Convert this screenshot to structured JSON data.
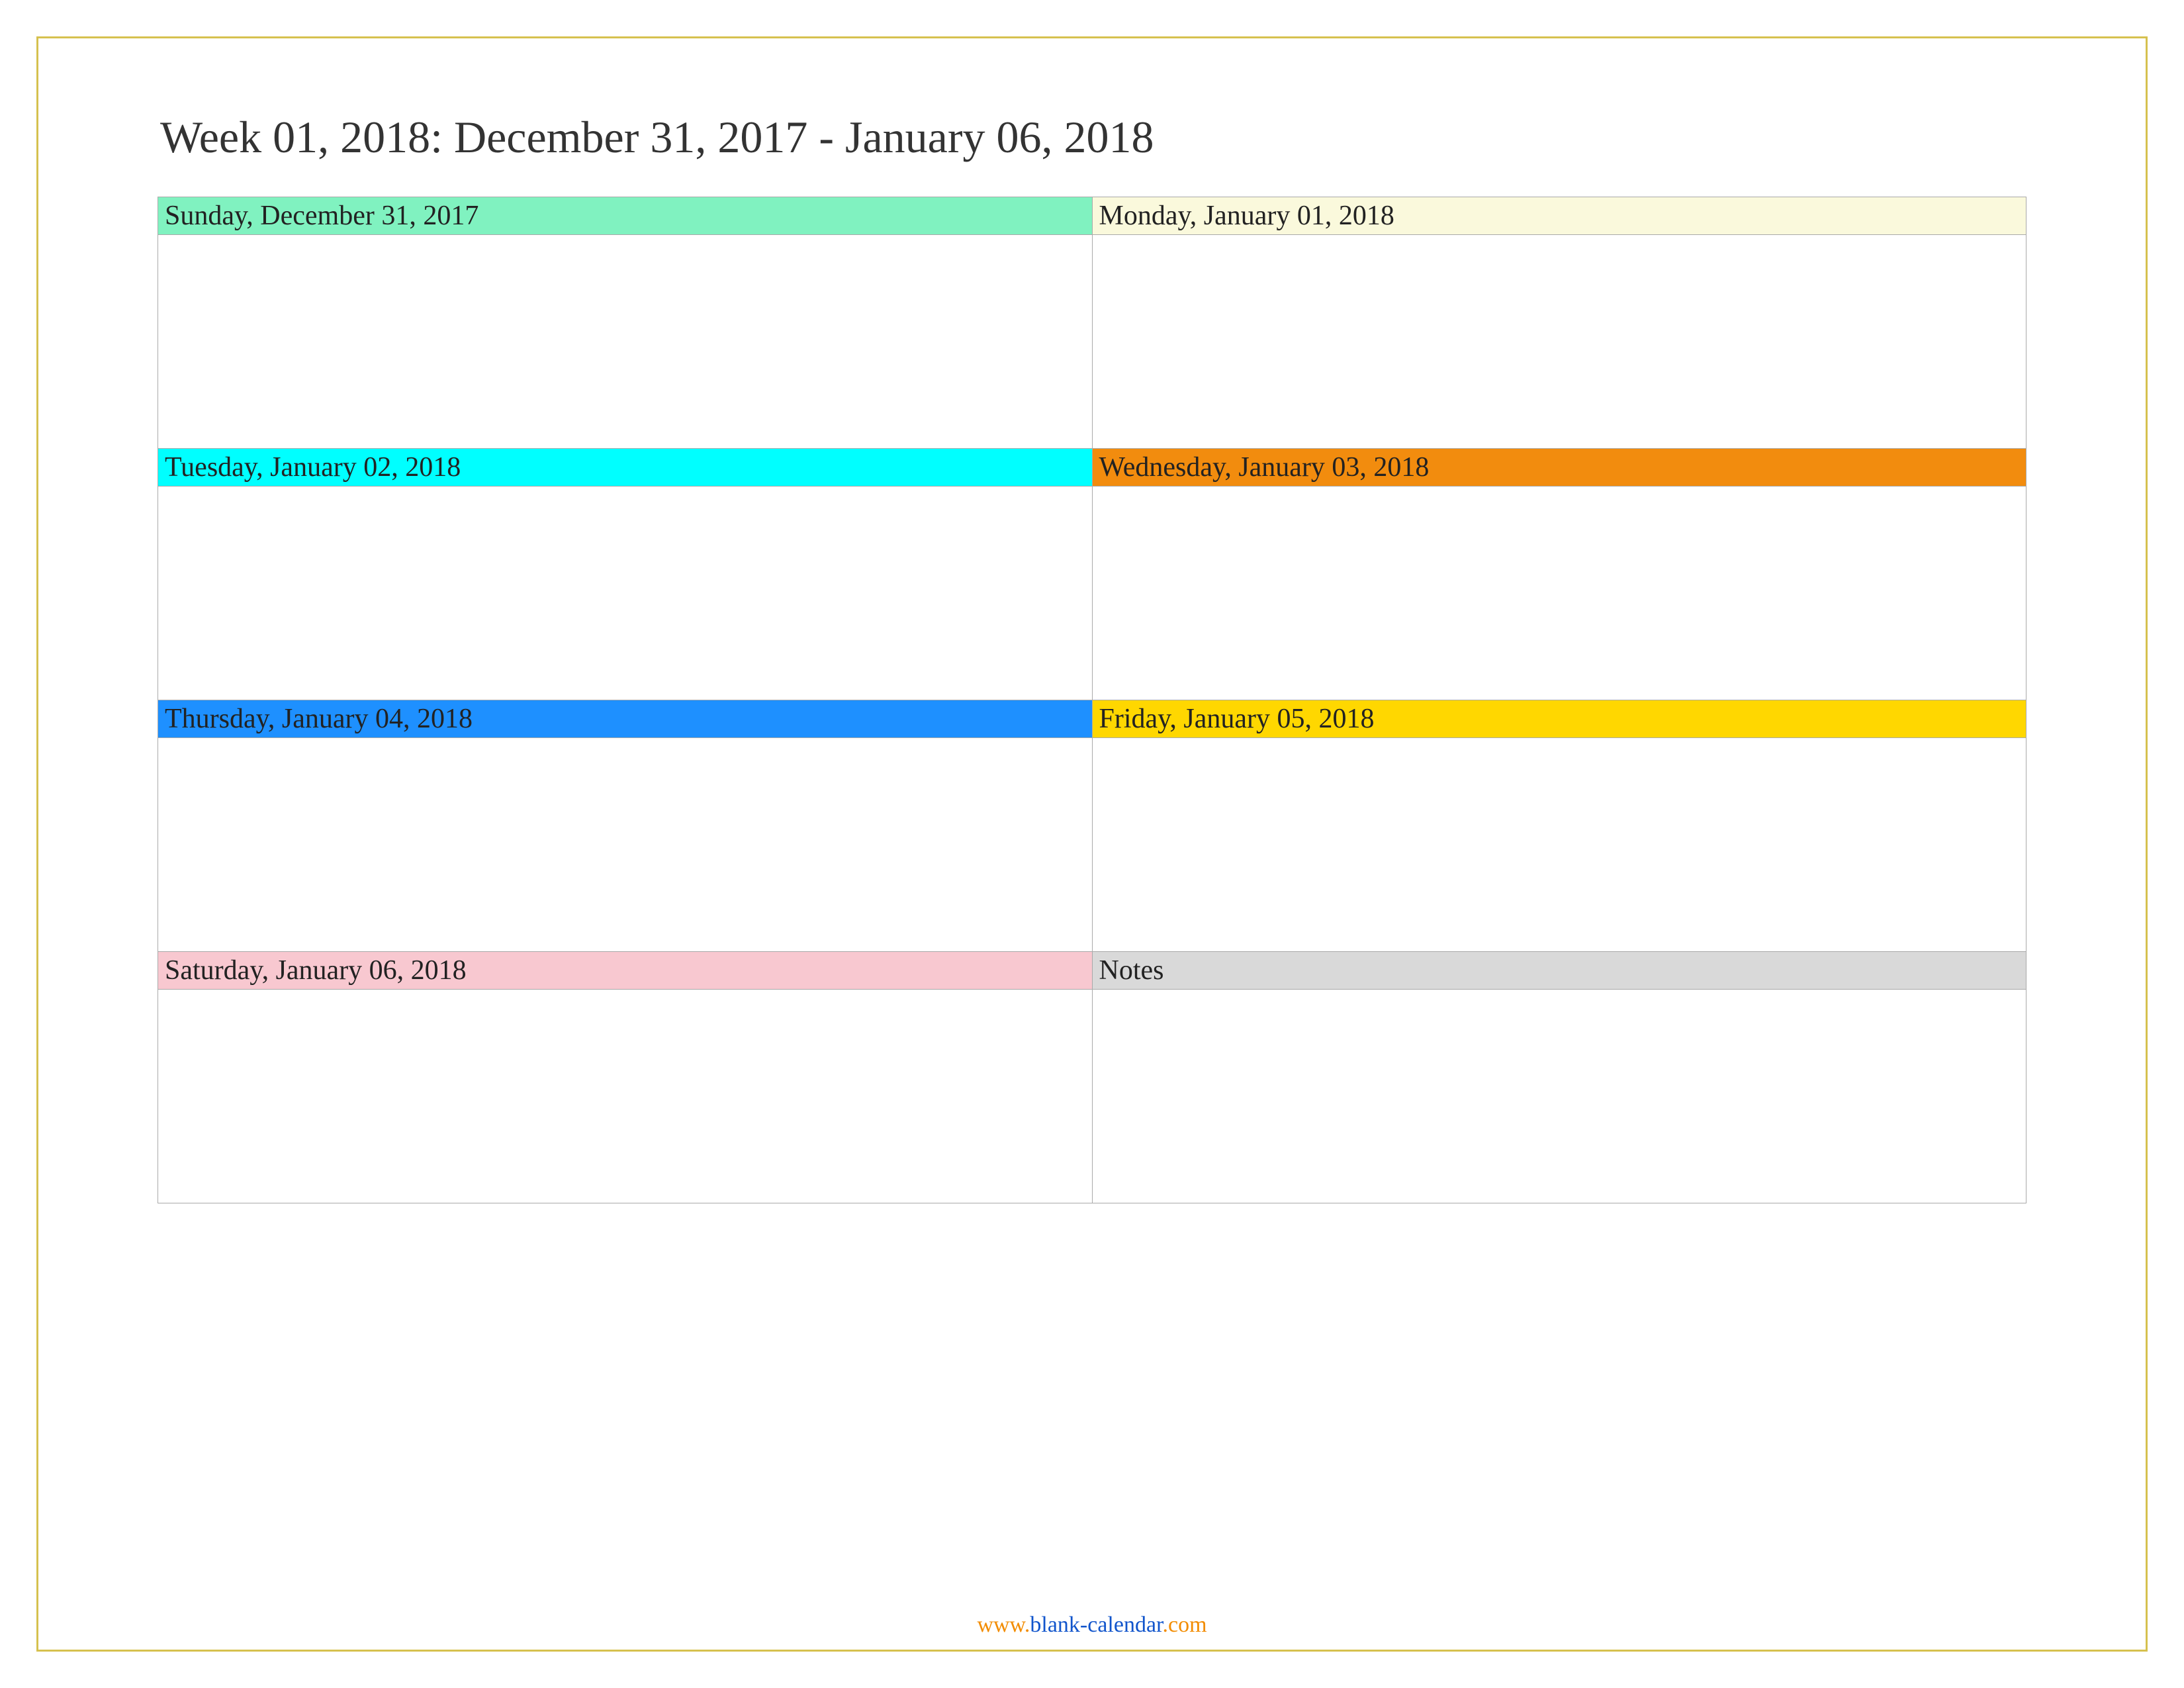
{
  "title": "Week 01, 2018: December 31, 2017 - January 06, 2018",
  "cells": {
    "sunday": {
      "label": "Sunday, December 31, 2017",
      "bg": "#80f2c0"
    },
    "monday": {
      "label": "Monday, January 01, 2018",
      "bg": "#faf9dc"
    },
    "tuesday": {
      "label": "Tuesday, January 02, 2018",
      "bg": "#00ffff"
    },
    "wednesday": {
      "label": "Wednesday, January 03, 2018",
      "bg": "#f28c0e"
    },
    "thursday": {
      "label": "Thursday, January 04, 2018",
      "bg": "#1e90ff"
    },
    "friday": {
      "label": "Friday, January 05, 2018",
      "bg": "#ffd700"
    },
    "saturday": {
      "label": "Saturday, January 06, 2018",
      "bg": "#f8c8d0"
    },
    "notes": {
      "label": "Notes",
      "bg": "#d9d9d9"
    }
  },
  "footer": {
    "prefix": "www.",
    "main": "blank-calendar",
    "suffix": ".com"
  }
}
